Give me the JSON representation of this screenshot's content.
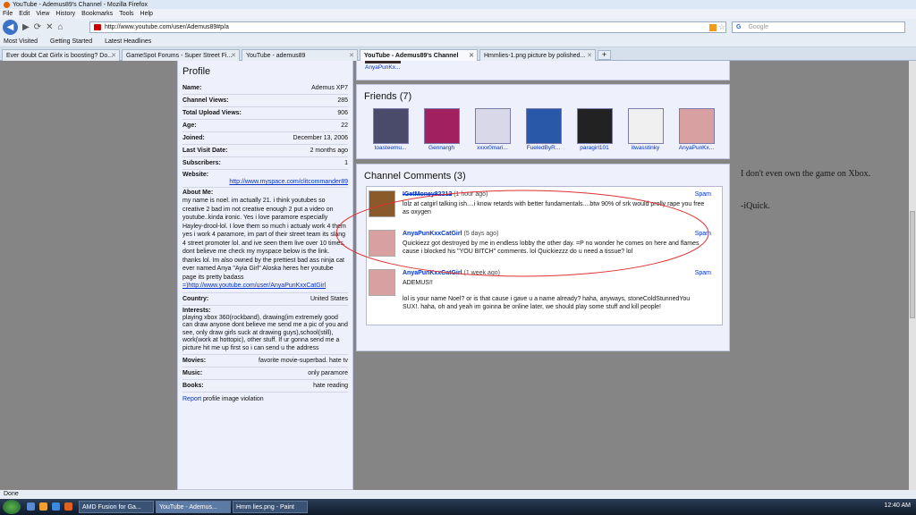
{
  "window": {
    "title": "YouTube - Ademus89's Channel - Mozilla Firefox"
  },
  "menu": [
    "File",
    "Edit",
    "View",
    "History",
    "Bookmarks",
    "Tools",
    "Help"
  ],
  "nav": {
    "url": "http://www.youtube.com/user/Ademus89#p/a",
    "search_placeholder": "Google"
  },
  "bookmarks": [
    "Most Visited",
    "Getting Started",
    "Latest Headlines"
  ],
  "tabs": [
    {
      "label": "Ever doubt Cat Girlx is boosting? Do..."
    },
    {
      "label": "GameSpot Forums - Super Street Fi..."
    },
    {
      "label": "YouTube - ademus89"
    },
    {
      "label": "YouTube - Ademus89's Channel"
    },
    {
      "label": "Hmmlies-1.png picture by polished..."
    }
  ],
  "profile": {
    "title": "Profile",
    "rows": [
      {
        "k": "Name:",
        "v": "Ademus XP7"
      },
      {
        "k": "Channel Views:",
        "v": "285"
      },
      {
        "k": "Total Upload Views:",
        "v": "906"
      },
      {
        "k": "Age:",
        "v": "22"
      },
      {
        "k": "Joined:",
        "v": "December 13, 2006"
      },
      {
        "k": "Last Visit Date:",
        "v": "2 months ago"
      },
      {
        "k": "Subscribers:",
        "v": "1"
      }
    ],
    "website_label": "Website:",
    "website": "http://www.myspace.com/clitcommander89",
    "about_label": "About Me:",
    "about_text": "my name is noel. im actually 21. i think youtubes so creative 2 bad im not creative enough 2 put a video on youtube..kinda ironic. Yes i love paramore especially Hayley-drool-lol. I love them so much i actualy work 4 them yes i work 4 paramore, im part of their street team its slang 4 street promoter lol. and ive seen them live over 10 times. dont believe me check my myspace below is the link. thanks lol. Im also owned by the prettiest bad ass ninja cat ever named Anya \"Ayia Girl\" Aloska heres her youtube page its pretty badass",
    "about_link": "=)http://www.youtube.com/user/AnyaPunKxxCatGirl",
    "country_label": "Country:",
    "country": "United States",
    "interests_label": "Interests:",
    "interests": "playing xbox 360(rockband), drawing(im extremely good can draw anyone dont believe me send me a pic of you and see, only draw girls suck at drawing guys),school(still), work(work at hottopic), other stuff. If ur gonna send me a picture hit me up first so i can send u the address",
    "movies_label": "Movies:",
    "movies": "favorite movie-superbad. hate tv",
    "music_label": "Music:",
    "music": "only paramore",
    "books_label": "Books:",
    "books": "hate reading",
    "report_link": "Report",
    "report_text": " profile image violation"
  },
  "top_strip": {
    "name": "AnyaPunKx..."
  },
  "friends": {
    "title": "Friends (7)",
    "items": [
      {
        "name": "toasteemu...",
        "color": "#4a4a6a"
      },
      {
        "name": "Gennargh",
        "color": "#a02060"
      },
      {
        "name": "xxxx0mari...",
        "color": "#d8d8e8"
      },
      {
        "name": "FueledByR...",
        "color": "#2a58a8"
      },
      {
        "name": "paragirl101",
        "color": "#222222"
      },
      {
        "name": "itwasstinky",
        "color": "#f0f0f0"
      },
      {
        "name": "AnyaPunKx...",
        "color": "#d8a0a0"
      }
    ]
  },
  "comments": {
    "title": "Channel Comments (3)",
    "spam_label": "Spam",
    "items": [
      {
        "user": "IGetMoney82212",
        "time": "(1 hour ago)",
        "text": "lolz at catgirl talking ish....i know retards with better fundamentals....btw 90% of srk would prolly rape you free as oxygen",
        "color": "#8a5a2a"
      },
      {
        "user": "AnyaPunKxxCatGirl",
        "time": "(5 days ago)",
        "text": "Quickiezz got destroyed by me in endless lobby the other day. =P no wonder he comes on here and flames cause i blocked his \"YOU BITCH\" comments. lol Quickiezzz do u need a tissue? lol",
        "color": "#d8a0a0"
      },
      {
        "user": "AnyaPunKxxCatGirl",
        "time": "(1 week ago)",
        "text": "ADEMUS!!\n\nlol is your name Noel? or is that cause i gave u a name already? haha, anyways, stoneColdStunnedYou SUX!. haha, oh and yeah im goinna be online later, we should play some stuff and kill people!",
        "color": "#d8a0a0"
      }
    ]
  },
  "side_note": {
    "line1": "I don't even own the game on Xbox.",
    "line2": "-iQuick."
  },
  "status": "Done",
  "taskbar": {
    "items": [
      "AMD Fusion for Ga...",
      "YouTube - Ademus...",
      "Hmm lies.png - Paint"
    ],
    "clock": "12:40 AM"
  }
}
